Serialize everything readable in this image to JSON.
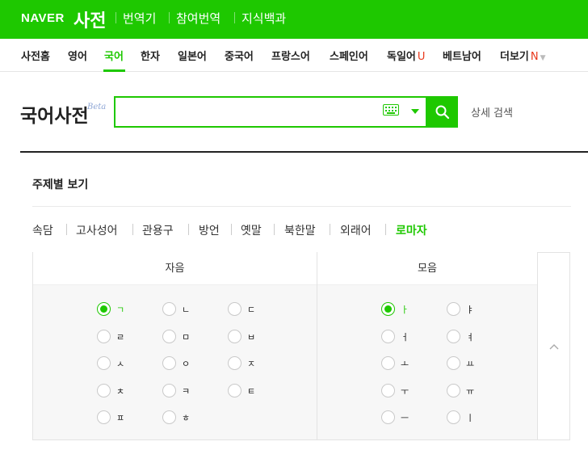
{
  "header": {
    "logo": "NAVER",
    "dict_title": "사전",
    "links": [
      "번역기",
      "참여번역",
      "지식백과"
    ]
  },
  "nav": {
    "items": [
      {
        "label": "사전홈",
        "badge": ""
      },
      {
        "label": "영어",
        "badge": ""
      },
      {
        "label": "국어",
        "badge": ""
      },
      {
        "label": "한자",
        "badge": ""
      },
      {
        "label": "일본어",
        "badge": ""
      },
      {
        "label": "중국어",
        "badge": ""
      },
      {
        "label": "프랑스어",
        "badge": ""
      },
      {
        "label": "스페인어",
        "badge": ""
      },
      {
        "label": "독일어",
        "badge": "U"
      },
      {
        "label": "베트남어",
        "badge": ""
      },
      {
        "label": "더보기",
        "badge": "N"
      }
    ],
    "active": "국어"
  },
  "search": {
    "label": "국어사전",
    "beta": "Beta",
    "value": "",
    "placeholder": "",
    "detail_link": "상세 검색"
  },
  "topics": {
    "title": "주제별 보기",
    "categories": [
      "속담",
      "고사성어",
      "관용구",
      "방언",
      "옛말",
      "북한말",
      "외래어",
      "로마자"
    ],
    "active": "로마자"
  },
  "jamo_table": {
    "consonants_header": "자음",
    "vowels_header": "모음",
    "consonants": [
      "ㄱ",
      "ㄴ",
      "ㄷ",
      "ㄹ",
      "ㅁ",
      "ㅂ",
      "ㅅ",
      "ㅇ",
      "ㅈ",
      "ㅊ",
      "ㅋ",
      "ㅌ",
      "ㅍ",
      "ㅎ"
    ],
    "vowels": [
      "ㅏ",
      "ㅑ",
      "ㅓ",
      "ㅕ",
      "ㅗ",
      "ㅛ",
      "ㅜ",
      "ㅠ",
      "ㅡ",
      "ㅣ"
    ],
    "selected_consonant": "ㄱ",
    "selected_vowel": "ㅏ"
  },
  "colors": {
    "brand_green": "#1ec800",
    "badge_red": "#e8381b"
  },
  "icons": [
    "keyboard-icon",
    "dropdown-caret-icon",
    "search-icon",
    "chevron-up-icon"
  ]
}
